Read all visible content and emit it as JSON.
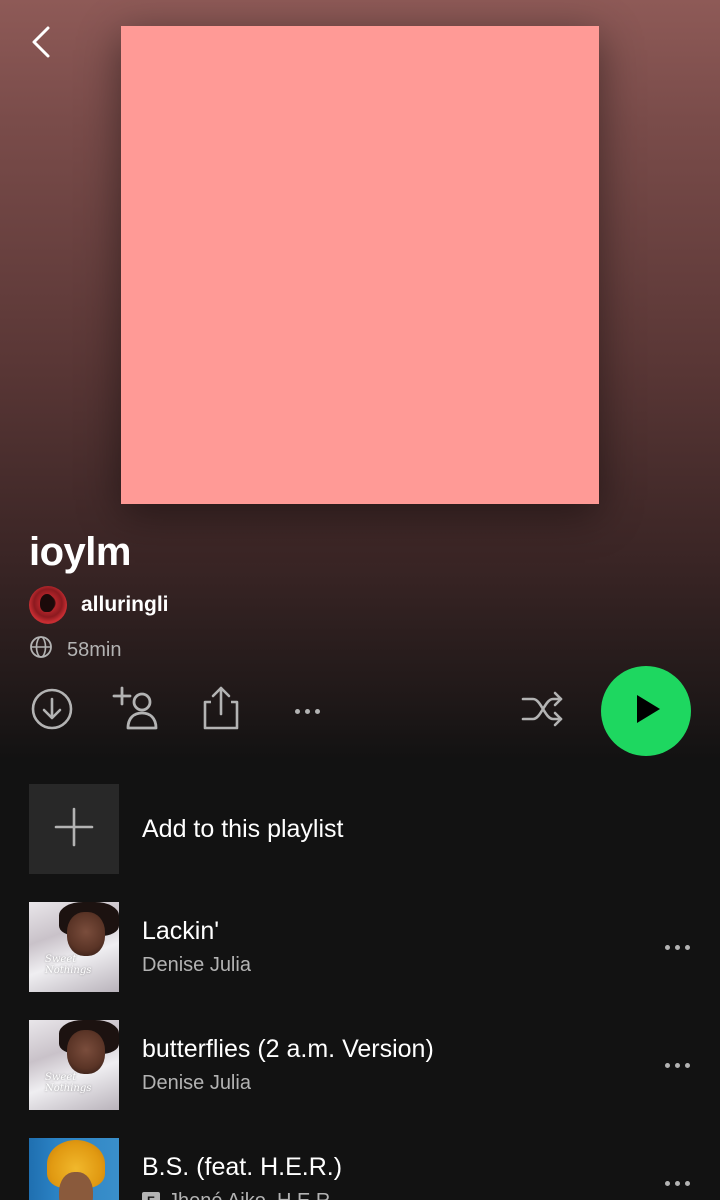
{
  "playlist": {
    "title": "ioylm",
    "owner": "alluringli",
    "duration": "58min",
    "cover_color": "#ff9a96"
  },
  "actions": {
    "icons": [
      "back-icon",
      "download-icon",
      "add-user-icon",
      "share-icon",
      "more-icon",
      "shuffle-icon",
      "play-icon"
    ],
    "accent": "#1ed760"
  },
  "add_row": {
    "label": "Add to this playlist"
  },
  "tracks": [
    {
      "title": "Lackin'",
      "artist": "Denise Julia",
      "explicit": false
    },
    {
      "title": "butterflies (2 a.m. Version)",
      "artist": "Denise Julia",
      "explicit": false
    },
    {
      "title": "B.S. (feat. H.E.R.)",
      "artist": "Jhené Aiko, H.E.R.",
      "explicit": true
    }
  ],
  "album_art_text": {
    "sweet_nothings": "Sweet\nNothings"
  }
}
